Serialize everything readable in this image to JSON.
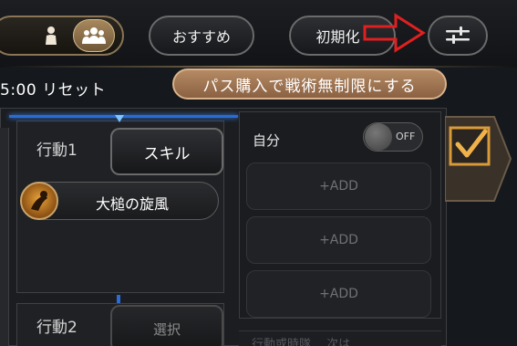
{
  "topbar": {
    "recommend_label": "おすすめ",
    "initial_label": "初期化",
    "filter_icon": "sliders-icon",
    "solo_icon": "person-icon",
    "party_icon": "group-icon"
  },
  "reset_text": "5:00 リセット",
  "pass_button": "パス購入で戦術無制限にする",
  "actions": [
    {
      "label": "行動1",
      "button": "スキル",
      "skill_name": "大槌の旋風"
    },
    {
      "label": "行動2",
      "button": "選択"
    }
  ],
  "conditions": {
    "self_label": "自分",
    "toggle_state": "OFF",
    "slots": [
      "+ADD",
      "+ADD",
      "+ADD"
    ],
    "footer_text": "行動或時隊 …次は"
  },
  "colors": {
    "accent_gold": "#b58a64",
    "highlight_blue": "#2a6bd6",
    "annotation_red": "#e02020"
  }
}
